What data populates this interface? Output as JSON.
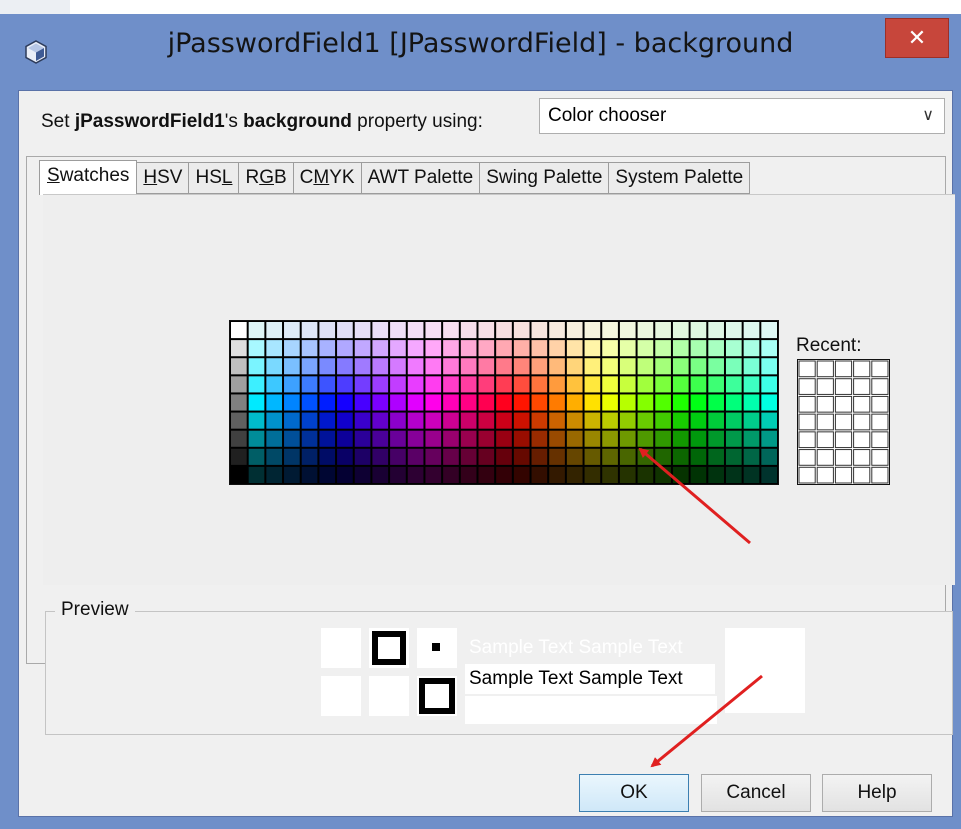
{
  "window": {
    "title": "jPasswordField1 [JPasswordField] - background",
    "close_glyph": "✕"
  },
  "property_line": {
    "prefix": "Set ",
    "component": "jPasswordField1",
    "possessive": "'s ",
    "property": "background",
    "suffix": " property using:"
  },
  "editor_combo": {
    "value": "Color chooser",
    "icon": "chevron-down-icon"
  },
  "tabs": [
    {
      "label": "Swatches",
      "mnemonic_index": 0,
      "active": true
    },
    {
      "label": "HSV",
      "mnemonic_index": 0,
      "active": false
    },
    {
      "label": "HSL",
      "mnemonic_index": 2,
      "active": false
    },
    {
      "label": "RGB",
      "mnemonic_index": 1,
      "active": false
    },
    {
      "label": "CMYK",
      "mnemonic_index": 1,
      "active": false
    },
    {
      "label": "AWT Palette",
      "mnemonic_index": -1,
      "active": false
    },
    {
      "label": "Swing Palette",
      "mnemonic_index": -1,
      "active": false
    },
    {
      "label": "System Palette",
      "mnemonic_index": -1,
      "active": false
    }
  ],
  "swatches": {
    "columns": 31,
    "rows": 9,
    "recent_columns": 5,
    "recent_rows": 7
  },
  "recent_label": "Recent:",
  "preview": {
    "label": "Preview",
    "sample_text_light": "Sample Text  Sample Text",
    "sample_text_dark": "Sample Text  Sample Text"
  },
  "buttons": {
    "ok": "OK",
    "cancel": "Cancel",
    "help": "Help"
  },
  "colors": {
    "title_bar": "#6f8fc9",
    "close_button": "#c7463b",
    "annotation_arrow": "#e02020"
  }
}
